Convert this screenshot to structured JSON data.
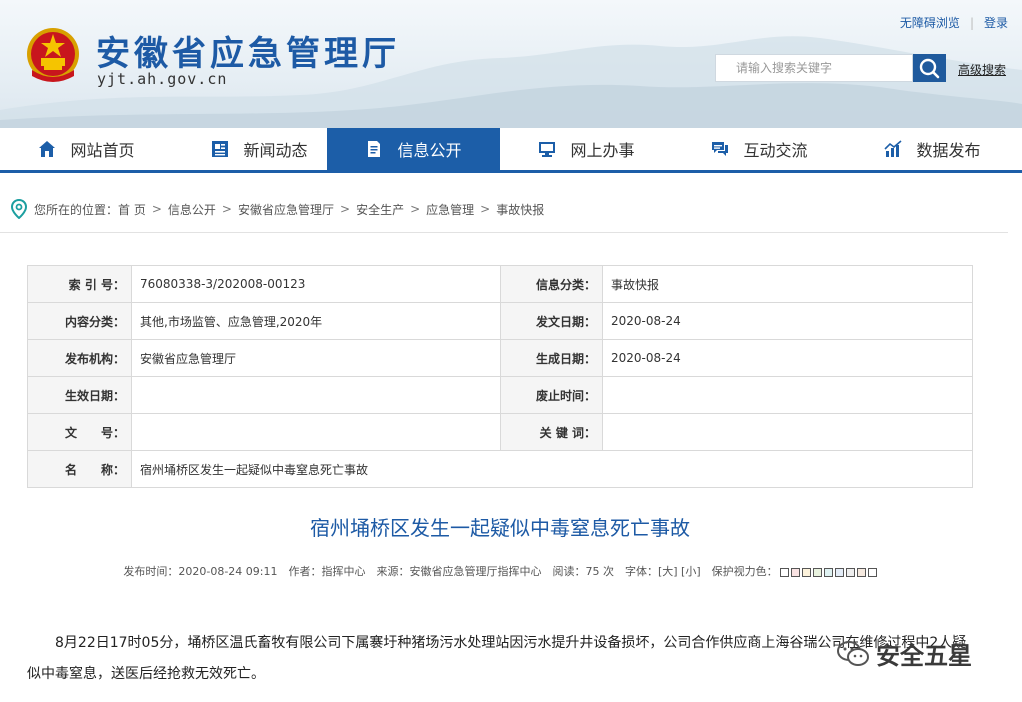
{
  "header": {
    "site_title": "安徽省应急管理厅",
    "site_domain": "yjt.ah.gov.cn",
    "accessibility_link": "无障碍浏览",
    "login_link": "登录",
    "search_placeholder": "请输入搜索关键字",
    "advanced_search": "高级搜索"
  },
  "nav": {
    "items": [
      {
        "label": "网站首页",
        "icon": "home-icon"
      },
      {
        "label": "新闻动态",
        "icon": "news-icon"
      },
      {
        "label": "信息公开",
        "icon": "document-icon"
      },
      {
        "label": "网上办事",
        "icon": "monitor-icon"
      },
      {
        "label": "互动交流",
        "icon": "chat-icon"
      },
      {
        "label": "数据发布",
        "icon": "chart-icon"
      }
    ],
    "active_index": 2,
    "accent_color": "#1c5ea8"
  },
  "breadcrumb": {
    "prefix": "您所在的位置：",
    "items": [
      "首 页",
      "信息公开",
      "安徽省应急管理厅",
      "安全生产",
      "应急管理",
      "事故快报"
    ],
    "separator": ">"
  },
  "meta": {
    "index_label": "索 引 号：",
    "index_value": "76080338-3/202008-00123",
    "category_label": "信息分类：",
    "category_value": "事故快报",
    "content_class_label": "内容分类：",
    "content_class_value": "其他,市场监管、应急管理,2020年",
    "publish_date_label": "发文日期：",
    "publish_date_value": "2020-08-24",
    "org_label": "发布机构：",
    "org_value": "安徽省应急管理厅",
    "generate_date_label": "生成日期：",
    "generate_date_value": "2020-08-24",
    "effective_date_label": "生效日期：",
    "effective_date_value": "",
    "repeal_time_label": "废止时间：",
    "repeal_time_value": "",
    "doc_no_label": "文　　号：",
    "doc_no_value": "",
    "keywords_label": "关 键 词：",
    "keywords_value": "",
    "name_label": "名　　称：",
    "name_value": "宿州埇桥区发生一起疑似中毒窒息死亡事故"
  },
  "article": {
    "title": "宿州埇桥区发生一起疑似中毒窒息死亡事故",
    "info": "发布时间：2020-08-24 09:11　作者：指挥中心　来源：安徽省应急管理厅指挥中心　阅读：75 次　字体：[大] [小]　保护视力色：",
    "body": "8月22日17时05分，埇桥区温氏畜牧有限公司下属褰圩种猪场污水处理站因污水提升井设备损坏，公司合作供应商上海谷瑞公司在维修过程中2人疑似中毒窒息，送医后经抢救无效死亡。"
  },
  "watermark": {
    "text": "安全五星"
  },
  "colors": {
    "brand_blue": "#1d5aa5",
    "nav_active": "#1c5ea8",
    "eye_colors": [
      "#ffffff",
      "#fae3e3",
      "#fdf3dc",
      "#e9f3df",
      "#dff2f2",
      "#e3ecf7",
      "#eeeeee",
      "#f6eae0",
      "#ffffff"
    ]
  }
}
